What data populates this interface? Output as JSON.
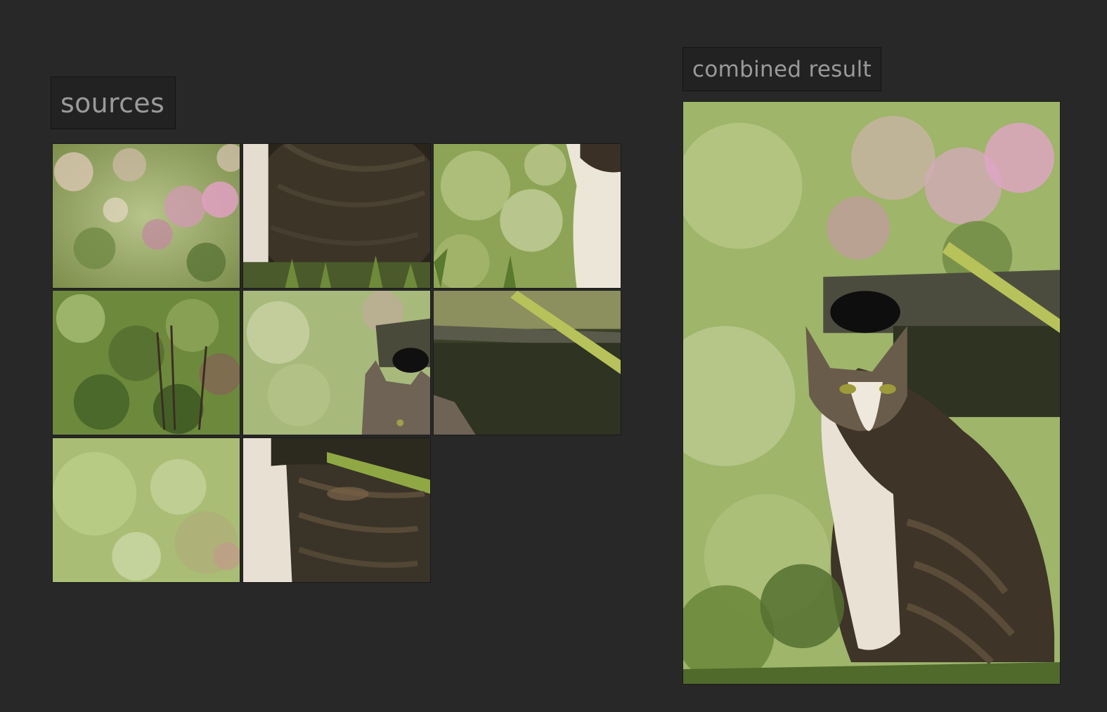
{
  "sources": {
    "title": "sources",
    "tiles": [
      {
        "content": "pink-flowers"
      },
      {
        "content": "cat-back-dark"
      },
      {
        "content": "cat-head-edge"
      },
      {
        "content": "green-foliage"
      },
      {
        "content": "cat-ears-pot"
      },
      {
        "content": "dark-pot-leaves"
      },
      {
        "content": "blurred-green"
      },
      {
        "content": "cat-body-sunlit"
      }
    ]
  },
  "result": {
    "title": "combined result",
    "content": "cat-in-garden-photo"
  },
  "colors": {
    "background": "#282828",
    "label_background": "#222222",
    "label_text": "#9a9a9a"
  }
}
